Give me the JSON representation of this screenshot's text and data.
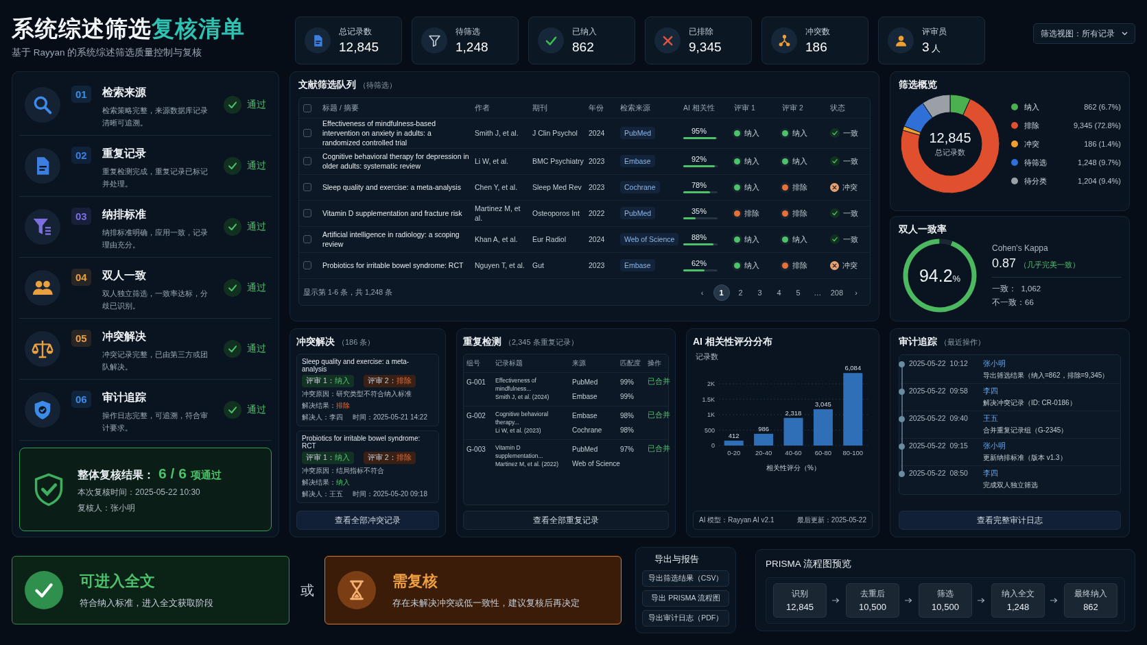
{
  "header": {
    "title": "系统综述筛选",
    "title_accent": "复核清单",
    "subtitle": "基于 Rayyan 的系统综述筛选质量控制与复核"
  },
  "kpis": [
    {
      "kind": "document",
      "label": "总记录数",
      "value": "12,845"
    },
    {
      "kind": "filter",
      "label": "待筛选",
      "value": "1,248"
    },
    {
      "kind": "check",
      "label": "已纳入",
      "value": "862"
    },
    {
      "kind": "cross",
      "label": "已排除",
      "value": "9,345"
    },
    {
      "kind": "network",
      "label": "冲突数",
      "value": "186"
    },
    {
      "kind": "person",
      "label": "评审员",
      "value": "3",
      "unit": "人"
    }
  ],
  "view_filter": "筛选视图：所有记录",
  "checklist": [
    {
      "kind": "search",
      "number": "01",
      "title": "检索来源",
      "description": "检索策略完整，来源数据库记录清晰可追溯。",
      "status": "通过",
      "passed": true
    },
    {
      "kind": "document",
      "number": "02",
      "title": "重复记录",
      "description": "重复检测完成，重复记录已标记并处理。",
      "status": "通过",
      "passed": true
    },
    {
      "kind": "filter-list",
      "number": "03",
      "title": "纳排标准",
      "description": "纳排标准明确，应用一致，记录理由充分。",
      "status": "通过",
      "passed": true
    },
    {
      "kind": "people",
      "number": "04",
      "title": "双人一致",
      "description": "双人独立筛选，一致率达标，分歧已识别。",
      "status": "通过",
      "passed": true
    },
    {
      "kind": "scale",
      "number": "05",
      "title": "冲突解决",
      "description": "冲突记录完整，已由第三方或团队解决。",
      "status": "通过",
      "passed": true
    },
    {
      "kind": "shield",
      "number": "06",
      "title": "审计追踪",
      "description": "操作日志完整，可追溯，符合审计要求。",
      "status": "通过",
      "passed": true
    }
  ],
  "overall": {
    "label": "整体复核结果：",
    "score": "6 / 6",
    "suffix": "项通过",
    "time": "本次复核时间：2025-05-22 10:30",
    "reviewer": "复核人：张小明"
  },
  "queue": {
    "title": "文献筛选队列",
    "subtitle": "（待筛选）",
    "all_checked": false,
    "columns": [
      "标题 / 摘要",
      "作者",
      "期刊",
      "年份",
      "检索来源",
      "AI 相关性",
      "评审 1",
      "评审 2",
      "状态"
    ],
    "rows": [
      {
        "checked": false,
        "title": "Effectiveness of mindfulness-based intervention on anxiety in adults: a randomized controlled trial",
        "author": "Smith J, et al.",
        "journal": "J Clin Psychol",
        "year": "2024",
        "source": "PubMed",
        "ai": "95%",
        "level": 0.95,
        "reviewer_1": {
          "decision": "纳入",
          "kind": "include"
        },
        "reviewer_2": {
          "decision": "纳入",
          "kind": "include"
        },
        "status": {
          "label": "一致",
          "kind": "agree"
        }
      },
      {
        "checked": false,
        "title": "Cognitive behavioral therapy for depression in older adults: systematic review",
        "author": "Li W, et al.",
        "journal": "BMC Psychiatry",
        "year": "2023",
        "source": "Embase",
        "ai": "92%",
        "level": 0.92,
        "reviewer_1": {
          "decision": "纳入",
          "kind": "include"
        },
        "reviewer_2": {
          "decision": "纳入",
          "kind": "include"
        },
        "status": {
          "label": "一致",
          "kind": "agree"
        }
      },
      {
        "checked": false,
        "title": "Sleep quality and exercise: a meta-analysis",
        "author": "Chen Y, et al.",
        "journal": "Sleep Med Rev",
        "year": "2023",
        "source": "Cochrane",
        "ai": "78%",
        "level": 0.78,
        "reviewer_1": {
          "decision": "纳入",
          "kind": "include"
        },
        "reviewer_2": {
          "decision": "排除",
          "kind": "exclude"
        },
        "status": {
          "label": "冲突",
          "kind": "conflict"
        }
      },
      {
        "checked": false,
        "title": "Vitamin D supplementation and fracture risk",
        "author": "Martinez M, et al.",
        "journal": "Osteoporos Int",
        "year": "2022",
        "source": "PubMed",
        "ai": "35%",
        "level": 0.35,
        "reviewer_1": {
          "decision": "排除",
          "kind": "exclude"
        },
        "reviewer_2": {
          "decision": "排除",
          "kind": "exclude"
        },
        "status": {
          "label": "一致",
          "kind": "agree"
        }
      },
      {
        "checked": false,
        "title": "Artificial intelligence in radiology: a scoping review",
        "author": "Khan A, et al.",
        "journal": "Eur Radiol",
        "year": "2024",
        "source": "Web of Science",
        "ai": "88%",
        "level": 0.88,
        "reviewer_1": {
          "decision": "纳入",
          "kind": "include"
        },
        "reviewer_2": {
          "decision": "纳入",
          "kind": "include"
        },
        "status": {
          "label": "一致",
          "kind": "agree"
        }
      },
      {
        "checked": false,
        "title": "Probiotics for irritable bowel syndrome: RCT",
        "author": "Nguyen T, et al.",
        "journal": "Gut",
        "year": "2023",
        "source": "Embase",
        "ai": "62%",
        "level": 0.62,
        "reviewer_1": {
          "decision": "纳入",
          "kind": "include"
        },
        "reviewer_2": {
          "decision": "排除",
          "kind": "exclude"
        },
        "status": {
          "label": "冲突",
          "kind": "conflict"
        }
      }
    ],
    "summary": "显示第 1-6 条，共 1,248 条",
    "prev": "‹",
    "next": "›",
    "pages": [
      {
        "label": "1",
        "kind": "page",
        "selected": true
      },
      {
        "label": "2",
        "kind": "page",
        "selected": false
      },
      {
        "label": "3",
        "kind": "page",
        "selected": false
      },
      {
        "label": "4",
        "kind": "page",
        "selected": false
      },
      {
        "label": "5",
        "kind": "page",
        "selected": false
      },
      {
        "label": "…",
        "kind": "gap"
      },
      {
        "label": "208",
        "kind": "page",
        "selected": false
      }
    ]
  },
  "overview": {
    "title": "筛选概览",
    "total": "12,845",
    "total_label": "总记录数",
    "legend": [
      {
        "value": "862 (6.7%)",
        "color": "#4caf50"
      },
      {
        "value": "9,345 (72.8%)",
        "color": "#e0502f"
      },
      {
        "value": "186 (1.4%)",
        "color": "#f0a030"
      },
      {
        "value": "1,248 (9.7%)",
        "color": "#2f6fd8"
      },
      {
        "value": "1,204 (9.4%)",
        "color": "#9aa0a6"
      }
    ],
    "chart_data": {
      "type": "donut",
      "categories": [
        "纳入",
        "排除",
        "冲突",
        "待筛选",
        "待分类"
      ],
      "values": [
        6.7,
        72.8,
        1.4,
        9.7,
        9.4
      ]
    }
  },
  "agreement": {
    "title": "双人一致率",
    "value": "94.2",
    "unit": "%",
    "level": 0.942,
    "kappa_label": "Cohen's Kappa",
    "kappa": "0.87",
    "kappa_note": "（几乎完美一致）",
    "agree": "一致：  1,062",
    "disagree": "不一致：66"
  },
  "conflicts": {
    "title": "冲突解决",
    "count": "（186 条）",
    "button": "查看全部冲突记录",
    "items": [
      {
        "title": "Sleep quality and exercise: a meta-analysis",
        "reviewer_1_label": "评审 1：",
        "reviewer_1": {
          "decision": "纳入",
          "kind": "include"
        },
        "reviewer_2_label": "评审 2：",
        "reviewer_2": {
          "decision": "排除",
          "kind": "exclude"
        },
        "reason": "冲突原因：研究类型不符合纳入标准",
        "result_label": "解决结果：",
        "result": {
          "decision": "排除",
          "kind": "exclude"
        },
        "resolver": "解决人：李四",
        "time": "时间：2025-05-21 14:22"
      },
      {
        "title": "Probiotics for irritable bowel syndrome: RCT",
        "reviewer_1_label": "评审 1：",
        "reviewer_1": {
          "decision": "纳入",
          "kind": "include"
        },
        "reviewer_2_label": "评审 2：",
        "reviewer_2": {
          "decision": "排除",
          "kind": "exclude"
        },
        "reason": "冲突原因：结局指标不符合",
        "result_label": "解决结果：",
        "result": {
          "decision": "纳入",
          "kind": "include"
        },
        "resolver": "解决人：王五",
        "time": "时间：2025-05-20 09:18"
      }
    ]
  },
  "duplicates": {
    "title": "重复检测",
    "count": "（2,345 条重复记录）",
    "button": "查看全部重复记录",
    "columns": [
      "组号",
      "记录标题",
      "来源",
      "匹配度",
      "操作"
    ],
    "groups": [
      {
        "id": "G-001",
        "title": "Effectiveness of mindfulness...",
        "meta": "Smith J, et al. (2024)",
        "sources": [
          {
            "name": "PubMed",
            "match": "99%"
          },
          {
            "name": "Embase",
            "match": "99%"
          }
        ],
        "action": "已合并"
      },
      {
        "id": "G-002",
        "title": "Cognitive behavioral therapy...",
        "meta": "Li W, et al. (2023)",
        "sources": [
          {
            "name": "Embase",
            "match": "98%"
          },
          {
            "name": "Cochrane",
            "match": "98%"
          }
        ],
        "action": "已合并"
      },
      {
        "id": "G-003",
        "title": "Vitamin D supplementation...",
        "meta": "Martinez M, et al. (2022)",
        "sources": [
          {
            "name": "PubMed",
            "match": "97%"
          },
          {
            "name": "Web of Science"
          }
        ],
        "action": "已合并"
      }
    ]
  },
  "relevance": {
    "title": "AI 相关性评分分布",
    "model": "AI 模型：Rayyan AI v2.1",
    "updated": "最后更新：2025-05-22",
    "y_axis_labels": [
      "2K",
      "1.5K",
      "1K",
      "500",
      "0"
    ],
    "chart_data": {
      "type": "bar",
      "ylabel": "记录数",
      "xlabel": "相关性评分（%）",
      "categories": [
        "0-20",
        "20-40",
        "40-60",
        "60-80",
        "80-100"
      ],
      "values": [
        412,
        986,
        2318,
        3045,
        6084
      ],
      "value_labels": [
        "412",
        "986",
        "2,318",
        "3,045",
        "6,084"
      ],
      "grid": true
    }
  },
  "audit": {
    "title": "审计追踪",
    "subtitle": "（最近操作）",
    "button": "查看完整审计日志",
    "entries": [
      {
        "time": "2025-05-22  10:12",
        "user": "张小明",
        "action": "导出筛选结果（纳入=862，排除=9,345）"
      },
      {
        "time": "2025-05-22  09:58",
        "user": "李四",
        "action": "解决冲突记录（ID: CR-0186）"
      },
      {
        "time": "2025-05-22  09:40",
        "user": "王五",
        "action": "合并重复记录组（G-2345）"
      },
      {
        "time": "2025-05-22  09:15",
        "user": "张小明",
        "action": "更新纳排标准（版本 v1.3）"
      },
      {
        "time": "2025-05-22  08:50",
        "user": "李四",
        "action": "完成双人独立筛选"
      }
    ]
  },
  "decisions": [
    {
      "kind": "proceed",
      "title": "可进入全文",
      "description": "符合纳入标准，进入全文获取阶段"
    },
    {
      "kind": "review",
      "title": "需复核",
      "description": "存在未解决冲突或低一致性，建议复核后再决定"
    }
  ],
  "decision_separator": "或",
  "export": {
    "title": "导出与报告",
    "buttons": [
      "导出筛选结果（CSV）",
      "导出 PRISMA 流程图",
      "导出审计日志（PDF）"
    ]
  },
  "prisma": {
    "title": "PRISMA 流程图预览",
    "stages": [
      {
        "label": "识别",
        "value": "12,845"
      },
      {
        "label": "去重后",
        "value": "10,500"
      },
      {
        "label": "筛选",
        "value": "10,500"
      },
      {
        "label": "纳入全文",
        "value": "1,248"
      },
      {
        "label": "最终纳入",
        "value": "862"
      }
    ]
  }
}
